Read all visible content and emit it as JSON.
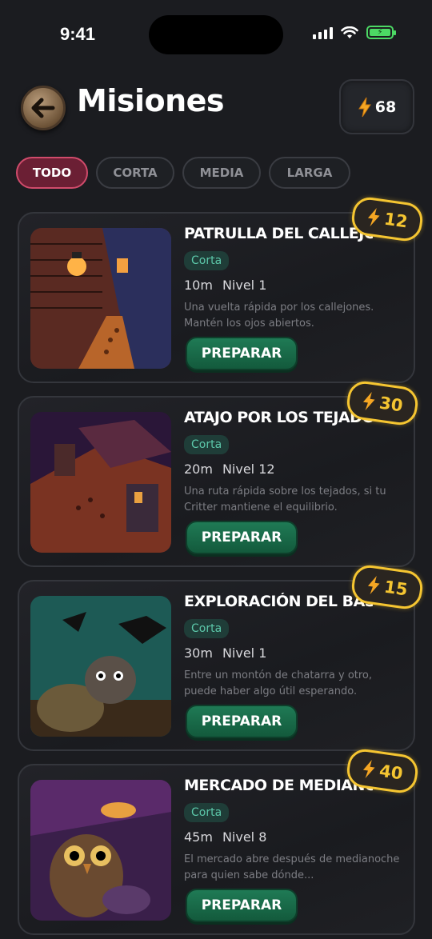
{
  "status_bar": {
    "time": "9:41"
  },
  "header": {
    "title": "Misiones",
    "energy": "68"
  },
  "tabs": [
    {
      "label": "TODO",
      "active": true
    },
    {
      "label": "CORTA",
      "active": false
    },
    {
      "label": "MEDIA",
      "active": false
    },
    {
      "label": "LARGA",
      "active": false
    }
  ],
  "missions": [
    {
      "title": "Patrulla del callejón",
      "reward": "12",
      "tag": "Corta",
      "duration": "10m",
      "level": "Nivel 1",
      "description": "Una vuelta rápida por los callejones. Mantén los ojos abiertos.",
      "button": "PREPARAR"
    },
    {
      "title": "Atajo por los tejados",
      "reward": "30",
      "tag": "Corta",
      "duration": "20m",
      "level": "Nivel 12",
      "description": "Una ruta rápida sobre los tejados, si tu Critter mantiene el equilibrio.",
      "button": "PREPARAR"
    },
    {
      "title": "Exploración del basurero",
      "reward": "15",
      "tag": "Corta",
      "duration": "30m",
      "level": "Nivel 1",
      "description": "Entre un montón de chatarra y otro, puede haber algo útil esperando.",
      "button": "PREPARAR"
    },
    {
      "title": "Mercado de medianoche",
      "reward": "40",
      "tag": "Corta",
      "duration": "45m",
      "level": "Nivel 8",
      "description": "El mercado abre después de medianoche para quien sabe dónde...",
      "button": "PREPARAR"
    }
  ],
  "colors": {
    "accent_gold": "#f5c531",
    "active_tab": "#6b1f34",
    "button_green": "#1f7a55",
    "tag_text": "#5cc7a9"
  }
}
